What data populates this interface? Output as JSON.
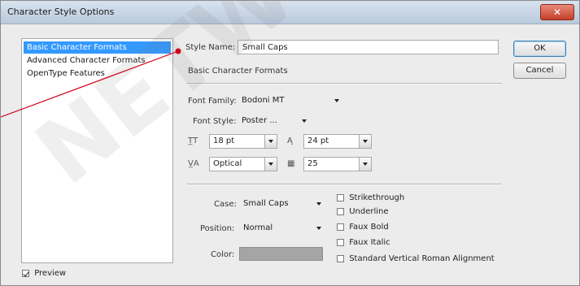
{
  "window": {
    "title": "Character Style Options",
    "close_glyph": "✕"
  },
  "sidebar": {
    "items": [
      {
        "label": "Basic Character Formats",
        "selected": true
      },
      {
        "label": "Advanced Character Formats",
        "selected": false
      },
      {
        "label": "OpenType Features",
        "selected": false
      }
    ],
    "preview": {
      "label": "Preview",
      "checked": true
    }
  },
  "form": {
    "style_name_label": "Style Name:",
    "style_name_value": "Small Caps",
    "section_title": "Basic Character Formats",
    "font_family_label": "Font Family:",
    "font_family_value": "Bodoni MT",
    "font_style_label": "Font Style:",
    "font_style_value": "Poster ...",
    "font_size_value": "18 pt",
    "leading_value": "24 pt",
    "kerning_value": "Optical",
    "tracking_value": "25",
    "case_label": "Case:",
    "case_value": "Small Caps",
    "position_label": "Position:",
    "position_value": "Normal",
    "color_label": "Color:",
    "color_value": "#a5a5a5",
    "checkboxes": [
      {
        "label": "Strikethrough",
        "checked": false
      },
      {
        "label": "Underline",
        "checked": false
      },
      {
        "label": "Faux Bold",
        "checked": false
      },
      {
        "label": "Faux Italic",
        "checked": false
      },
      {
        "label": "Standard Vertical Roman Alignment",
        "checked": false
      }
    ]
  },
  "buttons": {
    "ok": "OK",
    "cancel": "Cancel"
  },
  "watermark": {
    "text": "NETWO"
  },
  "colors": {
    "selection": "#3399ff",
    "pointer_line": "#d0021b",
    "window_bg": "#ececec"
  },
  "icons": {
    "font_size": "font-size-icon",
    "leading": "leading-icon",
    "kerning": "kerning-icon",
    "tracking": "tracking-icon"
  }
}
